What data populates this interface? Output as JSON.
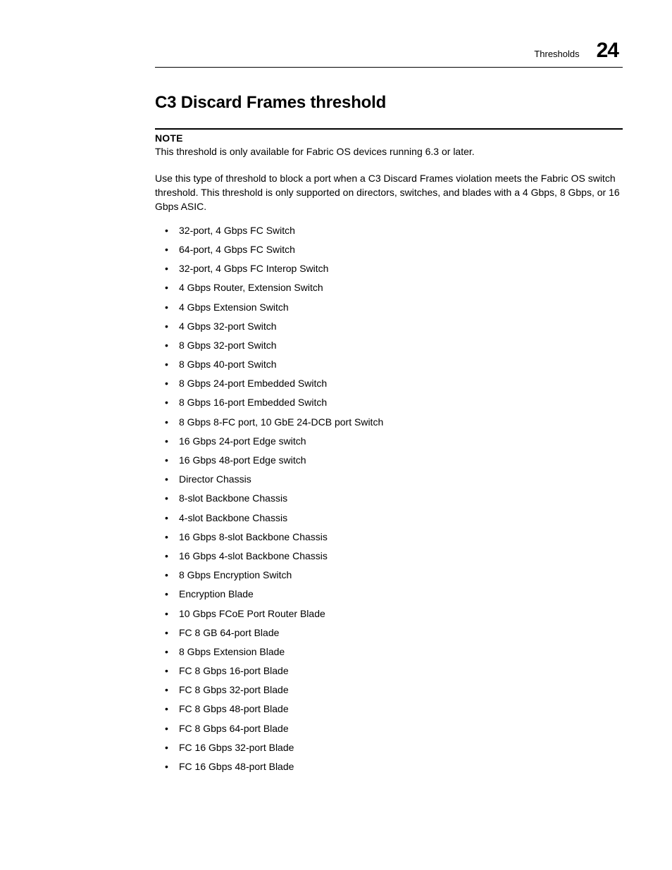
{
  "header": {
    "section": "Thresholds",
    "chapter": "24"
  },
  "title": "C3 Discard Frames threshold",
  "note": {
    "label": "NOTE",
    "text": "This threshold is only available for Fabric OS devices running 6.3 or later."
  },
  "intro": "Use this type of threshold to block a port when a C3 Discard Frames violation meets the Fabric OS switch threshold. This threshold is only supported on directors, switches, and blades with a 4 Gbps, 8 Gbps, or 16 Gbps ASIC.",
  "items": [
    "32-port, 4 Gbps FC Switch",
    "64-port, 4 Gbps FC Switch",
    "32-port, 4 Gbps FC Interop Switch",
    "4 Gbps Router, Extension Switch",
    "4 Gbps Extension Switch",
    "4 Gbps 32-port Switch",
    "8 Gbps 32-port Switch",
    "8 Gbps 40-port Switch",
    "8 Gbps 24-port Embedded Switch",
    "8 Gbps 16-port Embedded Switch",
    "8 Gbps 8-FC port, 10 GbE 24-DCB port Switch",
    "16 Gbps 24-port Edge switch",
    "16 Gbps 48-port Edge switch",
    "Director Chassis",
    "8-slot Backbone Chassis",
    "4-slot Backbone Chassis",
    "16 Gbps 8-slot Backbone Chassis",
    "16 Gbps 4-slot Backbone Chassis",
    "8 Gbps Encryption Switch",
    "Encryption Blade",
    "10 Gbps FCoE Port Router Blade",
    "FC 8 GB 64-port Blade",
    "8 Gbps Extension Blade",
    "FC 8 Gbps 16-port Blade",
    "FC 8 Gbps 32-port Blade",
    "FC 8 Gbps 48-port Blade",
    "FC 8 Gbps 64-port Blade",
    "FC 16 Gbps 32-port Blade",
    "FC 16 Gbps 48-port Blade"
  ]
}
